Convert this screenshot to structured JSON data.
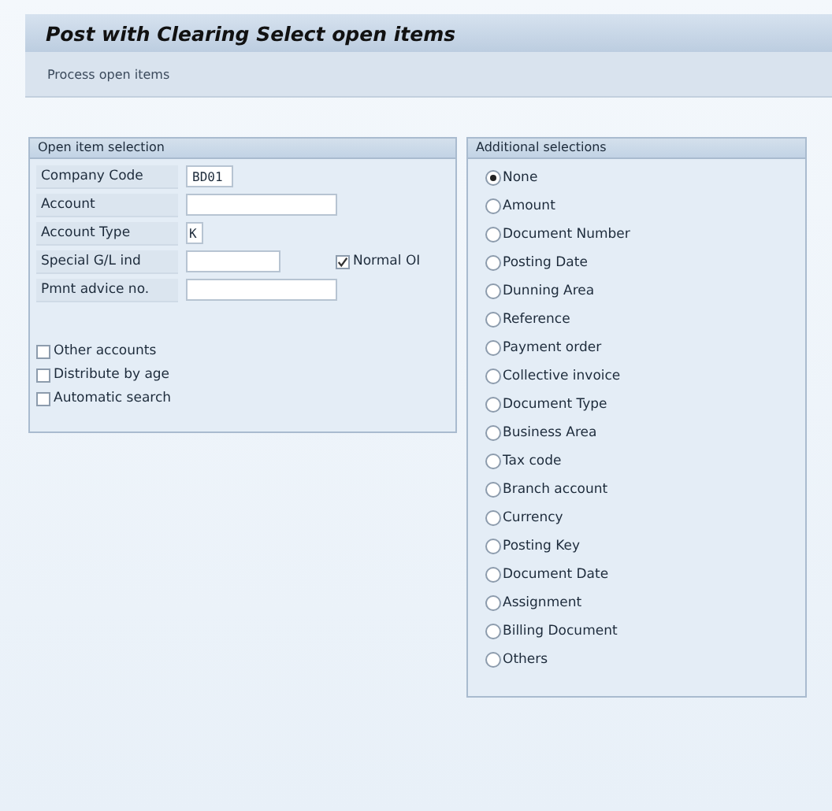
{
  "header": {
    "title": "Post with Clearing Select open items",
    "subtitle": "Process open items"
  },
  "open_item_selection": {
    "title": "Open item selection",
    "fields": [
      {
        "label": "Company Code",
        "value": "BD01"
      },
      {
        "label": "Account"
      },
      {
        "label": "Account Type",
        "value": "K"
      },
      {
        "label": "Special G/L ind",
        "checkbox": {
          "label": "Normal OI",
          "checked": true
        }
      },
      {
        "label": "Pmnt advice no."
      }
    ],
    "checkboxes": [
      {
        "label": "Other accounts",
        "checked": false
      },
      {
        "label": "Distribute by age",
        "checked": false
      },
      {
        "label": "Automatic search",
        "checked": false
      }
    ]
  },
  "additional_selections": {
    "title": "Additional selections",
    "options": [
      {
        "label": "None",
        "selected": true
      },
      {
        "label": "Amount",
        "selected": false
      },
      {
        "label": "Document Number",
        "selected": false
      },
      {
        "label": "Posting Date",
        "selected": false
      },
      {
        "label": "Dunning Area",
        "selected": false
      },
      {
        "label": "Reference",
        "selected": false
      },
      {
        "label": "Payment order",
        "selected": false
      },
      {
        "label": "Collective invoice",
        "selected": false
      },
      {
        "label": "Document Type",
        "selected": false
      },
      {
        "label": "Business Area",
        "selected": false
      },
      {
        "label": "Tax code",
        "selected": false
      },
      {
        "label": "Branch account",
        "selected": false
      },
      {
        "label": "Currency",
        "selected": false
      },
      {
        "label": "Posting Key",
        "selected": false
      },
      {
        "label": "Document Date",
        "selected": false
      },
      {
        "label": "Assignment",
        "selected": false
      },
      {
        "label": "Billing Document",
        "selected": false
      },
      {
        "label": "Others",
        "selected": false
      }
    ]
  }
}
